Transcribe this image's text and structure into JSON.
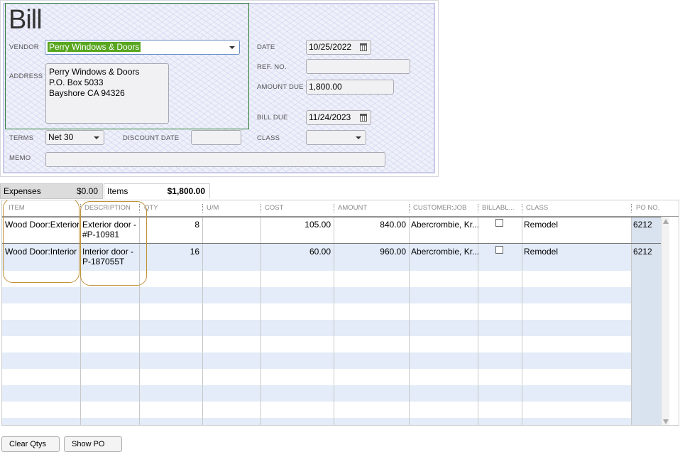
{
  "header": {
    "title": "Bill"
  },
  "vendor": {
    "label": "VENDOR",
    "value": "Perry Windows & Doors"
  },
  "address": {
    "label": "ADDRESS",
    "lines": [
      "Perry Windows & Doors",
      "P.O. Box 5033",
      "Bayshore CA 94326"
    ]
  },
  "date": {
    "label": "DATE",
    "value": "10/25/2022"
  },
  "ref_no": {
    "label": "REF. NO.",
    "value": ""
  },
  "amount_due": {
    "label": "AMOUNT DUE",
    "value": "1,800.00"
  },
  "bill_due": {
    "label": "BILL DUE",
    "value": "11/24/2023"
  },
  "terms": {
    "label": "TERMS",
    "value": "Net 30"
  },
  "discount_date": {
    "label": "DISCOUNT DATE",
    "value": ""
  },
  "class_field": {
    "label": "CLASS",
    "value": ""
  },
  "memo": {
    "label": "MEMO",
    "value": ""
  },
  "tabs": [
    {
      "label": "Expenses",
      "amount": "$0.00"
    },
    {
      "label": "Items",
      "amount": "$1,800.00"
    }
  ],
  "columns": [
    "ITEM",
    "DESCRIPTION",
    "QTY",
    "U/M",
    "COST",
    "AMOUNT",
    "CUSTOMER:JOB",
    "BILLABL...",
    "CLASS",
    "PO NO."
  ],
  "rows": [
    {
      "item": "Wood Door:Exterior",
      "desc1": "Exterior door -",
      "desc2": "#P-10981",
      "qty": "8",
      "um": "",
      "cost": "105.00",
      "amount": "840.00",
      "customer": "Abercrombie, Kr...",
      "billable": false,
      "class": "Remodel",
      "po": "6212"
    },
    {
      "item": "Wood Door:Interior",
      "desc1": "Interior door -",
      "desc2": "P-187055T",
      "qty": "16",
      "um": "",
      "cost": "60.00",
      "amount": "960.00",
      "customer": "Abercrombie, Kr...",
      "billable": false,
      "class": "Remodel",
      "po": "6212"
    }
  ],
  "buttons": {
    "clear_qtys": "Clear Qtys",
    "show_po": "Show PO"
  },
  "colors": {
    "vendor_highlight": "#58a61f",
    "annotation_oval": "#c0923a",
    "row_stripe": "#e3ecf8"
  }
}
